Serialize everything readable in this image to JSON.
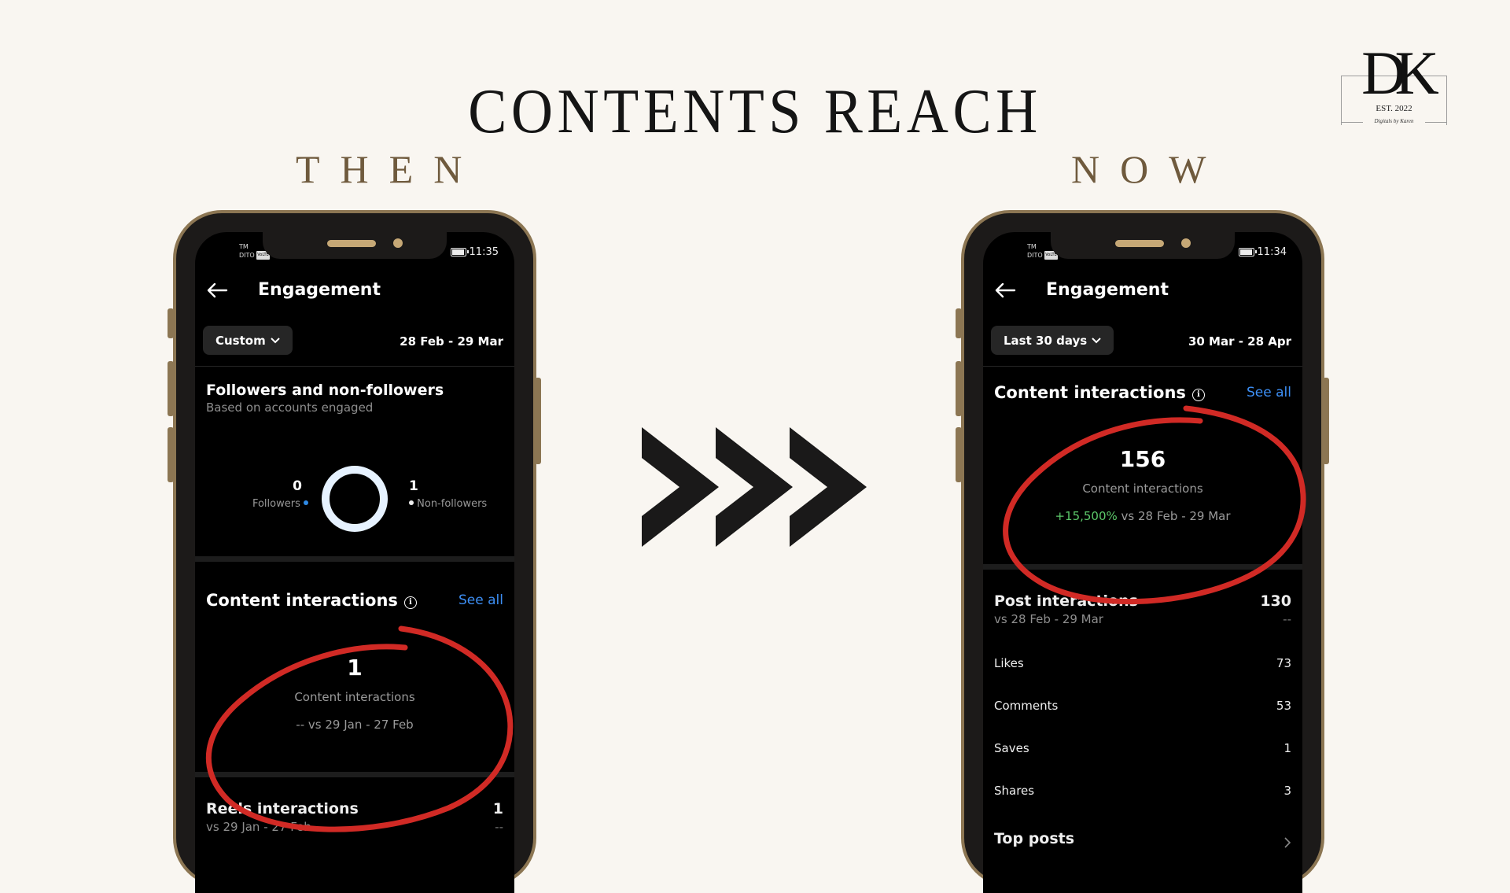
{
  "slide": {
    "title": "CONTENTS REACH",
    "then_label": "THEN",
    "now_label": "NOW",
    "logo": {
      "monogram": "DK",
      "est": "EST. 2022",
      "tagline": "Digitals by Karen"
    },
    "arrows_icon": "triple-chevron-right"
  },
  "colors": {
    "background": "#f9f6f1",
    "gold_frame": "#8c7653",
    "heading_dark": "#151515",
    "heading_gold": "#6f5a3d",
    "link_blue": "#3d8ff5",
    "growth_green": "#5cc86a",
    "annotation_red": "#d12a25"
  },
  "then_phone": {
    "status": {
      "carrier_top": "TM",
      "carrier_bottom": "DITO",
      "volte": "VoLTE",
      "time": "11:35",
      "battery_icon": "battery-icon"
    },
    "header": {
      "title": "Engagement",
      "back_icon": "arrow-left-icon"
    },
    "range": {
      "selector_label": "Custom",
      "dates": "28 Feb - 29 Mar"
    },
    "followers_section": {
      "title": "Followers and non-followers",
      "subtitle": "Based on accounts engaged",
      "followers_value": "0",
      "followers_label": "Followers",
      "non_followers_value": "1",
      "non_followers_label": "Non-followers",
      "followers_share": 0,
      "non_followers_share": 1
    },
    "content_interactions": {
      "title": "Content interactions",
      "see_all": "See all",
      "value": "1",
      "label": "Content interactions",
      "change": "--",
      "comparison": "vs 29 Jan - 27 Feb"
    },
    "reels_interactions": {
      "title": "Reels interactions",
      "comparison": "vs 29 Jan - 27 Feb",
      "value": "1",
      "change": "--"
    }
  },
  "now_phone": {
    "status": {
      "carrier_top": "TM",
      "carrier_bottom": "DITO",
      "volte": "VoLTE",
      "time": "11:34",
      "battery_icon": "battery-icon"
    },
    "header": {
      "title": "Engagement",
      "back_icon": "arrow-left-icon"
    },
    "range": {
      "selector_label": "Last 30 days",
      "dates": "30 Mar - 28 Apr"
    },
    "content_interactions": {
      "title": "Content interactions",
      "see_all": "See all",
      "value": "156",
      "label": "Content interactions",
      "change": "+15,500%",
      "comparison": "vs 28 Feb - 29 Mar"
    },
    "post_interactions": {
      "title": "Post interactions",
      "comparison": "vs 28 Feb - 29 Mar",
      "value": "130",
      "change": "--",
      "breakdown": [
        {
          "label": "Likes",
          "value": "73"
        },
        {
          "label": "Comments",
          "value": "53"
        },
        {
          "label": "Saves",
          "value": "1"
        },
        {
          "label": "Shares",
          "value": "3"
        }
      ]
    },
    "top_posts": {
      "title": "Top posts"
    }
  }
}
